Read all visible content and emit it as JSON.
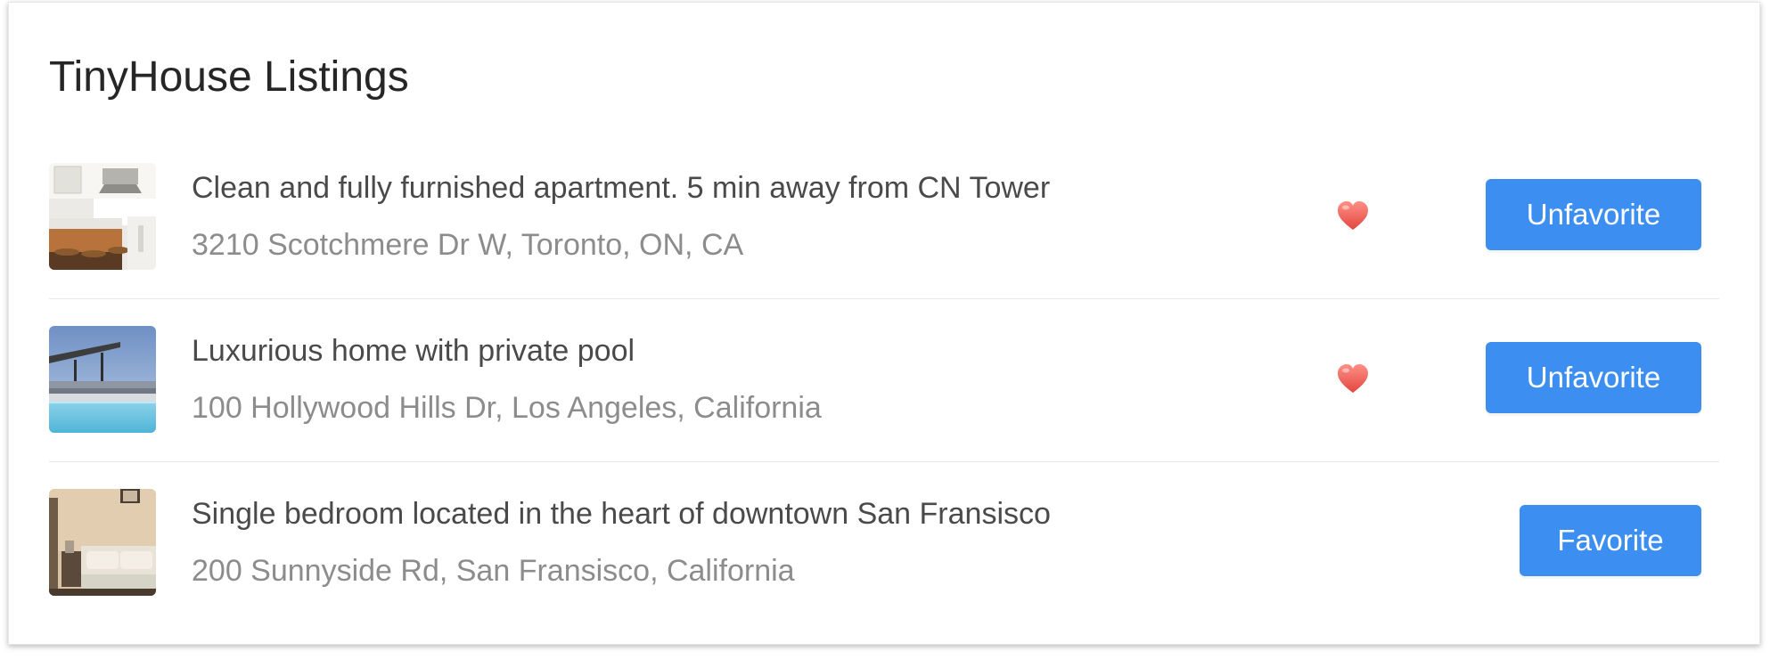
{
  "page": {
    "title": "TinyHouse Listings"
  },
  "listings": [
    {
      "title": "Clean and fully furnished apartment. 5 min away from CN Tower",
      "address": "3210 Scotchmere Dr W, Toronto, ON, CA",
      "favorited": true,
      "button_label": "Unfavorite",
      "icon": "heart-icon",
      "image": "kitchen-photo"
    },
    {
      "title": "Luxurious home with private pool",
      "address": "100 Hollywood Hills Dr, Los Angeles, California",
      "favorited": true,
      "button_label": "Unfavorite",
      "icon": "heart-icon",
      "image": "pool-photo"
    },
    {
      "title": "Single bedroom located in the heart of downtown San Fransisco",
      "address": "200 Sunnyside Rd, San Fransisco, California",
      "favorited": false,
      "button_label": "Favorite",
      "image": "bedroom-photo"
    }
  ],
  "colors": {
    "primary": "#3c8ff0",
    "heart": "#f0625f"
  }
}
